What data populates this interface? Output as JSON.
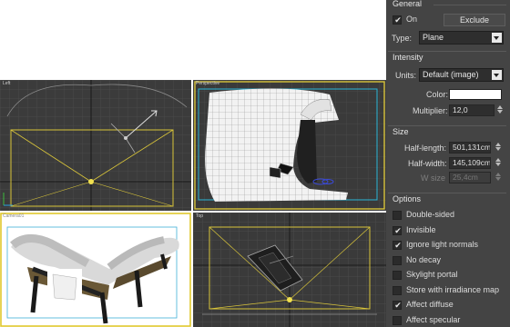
{
  "viewports": {
    "top_left": {
      "label": "Left"
    },
    "top_right": {
      "label": "Perspective"
    },
    "bottom_left": {
      "label": "Camera01"
    },
    "bottom_right": {
      "label": "Top"
    }
  },
  "general": {
    "title": "General",
    "on_label": "On",
    "on_checked": true,
    "exclude_label": "Exclude",
    "type_label": "Type:",
    "type_value": "Plane"
  },
  "intensity": {
    "title": "Intensity",
    "units_label": "Units:",
    "units_value": "Default (image)",
    "color_label": "Color:",
    "color_value": "#ffffff",
    "multiplier_label": "Multiplier:",
    "multiplier_value": "12,0"
  },
  "size": {
    "title": "Size",
    "half_length_label": "Half-length:",
    "half_length_value": "501,131cm",
    "half_width_label": "Half-width:",
    "half_width_value": "145,109cm",
    "w_size_label": "W size",
    "w_size_value": "25,4cm"
  },
  "options": {
    "title": "Options",
    "items": [
      {
        "label": "Double-sided",
        "checked": false
      },
      {
        "label": "Invisible",
        "checked": true
      },
      {
        "label": "Ignore light normals",
        "checked": true
      },
      {
        "label": "No decay",
        "checked": false
      },
      {
        "label": "Skylight portal",
        "checked": false
      },
      {
        "label": "Store with irradiance map",
        "checked": false
      },
      {
        "label": "Affect diffuse",
        "checked": true
      },
      {
        "label": "Affect specular",
        "checked": false
      }
    ]
  }
}
